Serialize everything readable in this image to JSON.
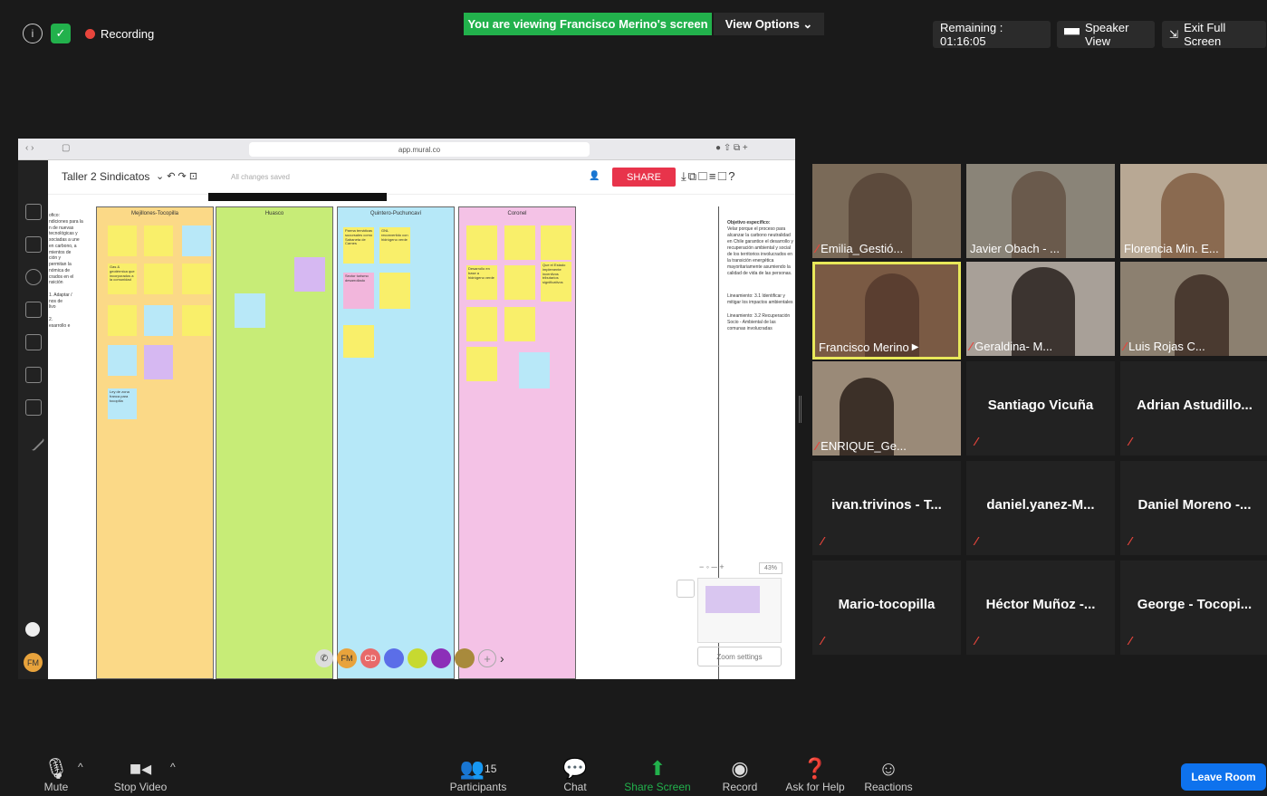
{
  "topbar": {
    "recording": "Recording",
    "viewing": "You are viewing Francisco Merino's screen",
    "view_options": "View Options ⌄",
    "remaining": "Remaining : 01:16:05",
    "speaker_view": "Speaker View",
    "exit_full": "Exit Full Screen"
  },
  "shared": {
    "url": "app.mural.co",
    "board_title": "Taller 2 Sindicatos",
    "saved": "All changes saved",
    "share_btn": "SHARE",
    "columns": [
      "Mejillones-Tocopilla",
      "Huasco",
      "Quintero-Puchuncaví",
      "Coronel"
    ],
    "left_text": "ofico:\nndiciones para la\nn de nuevas\ntecnológicas y\nsociadas a une\nen carbono, a\nmientos de\nción y\npermitan la\nnómica de\ncrados en el\nnsición\n\n1. Adaptar /\nnos de\nlivo\n\n2.\nesarrollo e",
    "objective_title": "Objetivo específico:",
    "objective_text": "Velar porque el proceso para alcanzar la carbono neutralidad en Chile garantice el desarrollo y recuperación ambiental y social de los territorios involucrados en la transición energética mayoritariamente asumiendo la calidad de vida de las personas.",
    "lin1": "Lineamiento: 3.1 Identificar y mitigar los impactos ambientales",
    "lin2": "Lineamiento: 3.2 Recuperación Socio - Ambiental de las comunas involucradas",
    "zoom_pct": "43%",
    "zoom_settings": "Zoom settings",
    "avatar_fm": "FM",
    "avatar_cd": "CD",
    "notes_quintero": [
      "Parma temáticas sucursales como Sabaneta de Carnes",
      "GNL reconvertido con hidrógeno verde",
      "Sector turismo desarrollado"
    ],
    "notes_coronel": [
      "Desarrollo en base a hidrógeno verde",
      "Que el Estado implemente incentivos tributarios significativos"
    ],
    "notes_mej": [
      "Gas & geotérmica que incorporados a la comunidad",
      "Ley de zona franca para tocopilla"
    ]
  },
  "participants": [
    {
      "name": "Emilia_Gestió...",
      "video": true,
      "muted": true
    },
    {
      "name": "Javier Obach - ...",
      "video": true,
      "muted": false
    },
    {
      "name": "Florencia Min. E...",
      "video": true,
      "muted": false
    },
    {
      "name": "Francisco Merino",
      "video": true,
      "muted": false,
      "active": true
    },
    {
      "name": "Geraldina- M...",
      "video": true,
      "muted": true
    },
    {
      "name": "Luis Rojas C...",
      "video": true,
      "muted": true
    },
    {
      "name": "ENRIQUE_Ge...",
      "video": true,
      "muted": true
    },
    {
      "name": "Santiago Vicuña",
      "video": false,
      "muted": true
    },
    {
      "name": "Adrian Astudillo...",
      "video": false,
      "muted": true
    },
    {
      "name": "ivan.trivinos - T...",
      "video": false,
      "muted": true
    },
    {
      "name": "daniel.yanez-M...",
      "video": false,
      "muted": true
    },
    {
      "name": "Daniel Moreno -...",
      "video": false,
      "muted": true
    },
    {
      "name": "Mario-tocopilla",
      "video": false,
      "muted": true
    },
    {
      "name": "Héctor Muñoz -...",
      "video": false,
      "muted": true
    },
    {
      "name": "George - Tocopi...",
      "video": false,
      "muted": true
    }
  ],
  "bottombar": {
    "mute": "Mute",
    "stop_video": "Stop Video",
    "participants": "Participants",
    "participants_count": "15",
    "chat": "Chat",
    "share_screen": "Share Screen",
    "record": "Record",
    "ask_help": "Ask for Help",
    "reactions": "Reactions",
    "leave": "Leave Room"
  },
  "colors": {
    "viewing_bar": "#22b14c",
    "leave": "#0e72ed",
    "share_btn": "#e8344b",
    "active_border": "#e8e85a"
  }
}
